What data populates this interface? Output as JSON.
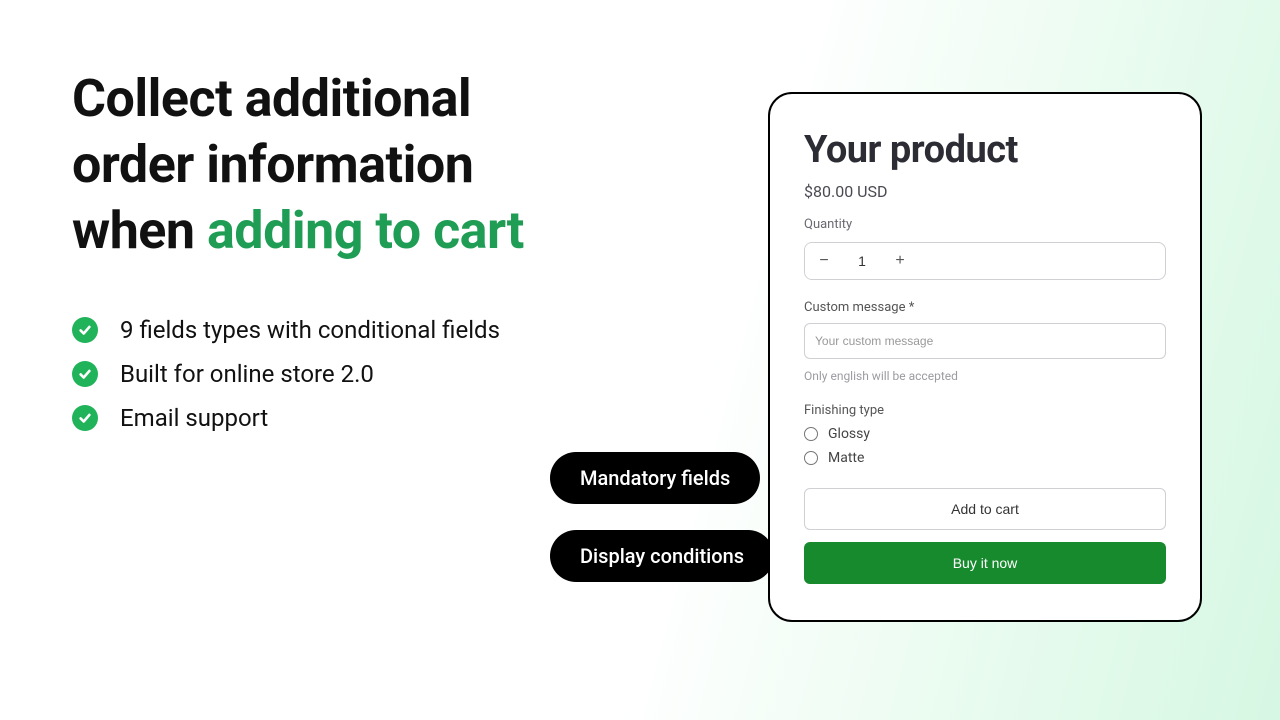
{
  "heading": {
    "line1": "Collect additional",
    "line2": "order information",
    "line3_prefix": "when ",
    "line3_accent": "adding to cart"
  },
  "features": [
    "9 fields types with conditional fields",
    "Built for online store 2.0",
    "Email support"
  ],
  "pills": {
    "mandatory": "Mandatory fields",
    "display": "Display conditions"
  },
  "product": {
    "title": "Your product",
    "price": "$80.00 USD",
    "quantity_label": "Quantity",
    "quantity_value": "1",
    "custom_message_label": "Custom message *",
    "custom_message_placeholder": "Your custom message",
    "custom_message_hint": "Only english will be accepted",
    "finishing_label": "Finishing type",
    "finishing_options": [
      "Glossy",
      "Matte"
    ],
    "add_to_cart": "Add to cart",
    "buy_now": "Buy it now"
  }
}
